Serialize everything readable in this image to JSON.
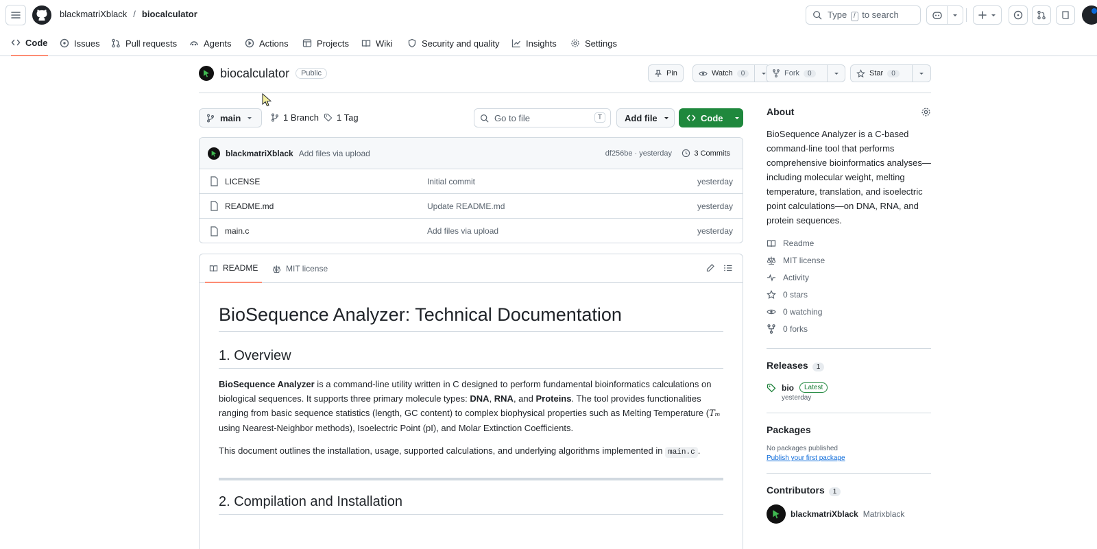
{
  "header": {
    "owner": "blackmatriXblack",
    "separator": "/",
    "repo": "biocalculator",
    "search_prefix": "Type",
    "search_key": "/",
    "search_suffix": "to search"
  },
  "nav": {
    "tabs": [
      {
        "label": "Code"
      },
      {
        "label": "Issues"
      },
      {
        "label": "Pull requests"
      },
      {
        "label": "Agents"
      },
      {
        "label": "Actions"
      },
      {
        "label": "Projects"
      },
      {
        "label": "Wiki"
      },
      {
        "label": "Security and quality"
      },
      {
        "label": "Insights"
      },
      {
        "label": "Settings"
      }
    ]
  },
  "repo": {
    "name": "biocalculator",
    "visibility": "Public",
    "pin_label": "Pin",
    "watch_label": "Watch",
    "watch_count": "0",
    "fork_label": "Fork",
    "fork_count": "0",
    "star_label": "Star",
    "star_count": "0"
  },
  "branch_bar": {
    "branch": "main",
    "branches": "1 Branch",
    "tags": "1 Tag",
    "goto_placeholder": "Go to file",
    "goto_key": "T",
    "add_file": "Add file",
    "code": "Code"
  },
  "commit": {
    "author": "blackmatriXblack",
    "message": "Add files via upload",
    "hash_time": "df256be · yesterday",
    "commits": "3 Commits"
  },
  "files": [
    {
      "name": "LICENSE",
      "message": "Initial commit",
      "date": "yesterday"
    },
    {
      "name": "README.md",
      "message": "Update README.md",
      "date": "yesterday"
    },
    {
      "name": "main.c",
      "message": "Add files via upload",
      "date": "yesterday"
    }
  ],
  "readme": {
    "tab_readme": "README",
    "tab_license": "MIT license",
    "h1": "BioSequence Analyzer: Technical Documentation",
    "h2_overview": "1. Overview",
    "p1_bold": "BioSequence Analyzer",
    "p1_a": " is a command-line utility written in C designed to perform fundamental bioinformatics calculations on biological sequences. It supports three primary molecule types: ",
    "p1_dna": "DNA",
    "p1_sep1": ", ",
    "p1_rna": "RNA",
    "p1_sep2": ", and ",
    "p1_proteins": "Proteins",
    "p1_b": ". The tool provides functionalities ranging from basic sequence statistics (length, GC content) to complex biophysical properties such as Melting Temperature (",
    "p1_tm": "Tₘ",
    "p1_c": " using Nearest-Neighbor methods), Isoelectric Point (pI), and Molar Extinction Coefficients.",
    "p2_a": "This document outlines the installation, usage, supported calculations, and underlying algorithms implemented in ",
    "p2_code": "main.c",
    "p2_b": ".",
    "h2_compile": "2. Compilation and Installation"
  },
  "about": {
    "title": "About",
    "description": "BioSequence Analyzer is a C-based command-line tool that performs comprehensive bioinformatics analyses—including molecular weight, melting temperature, translation, and isoelectric point calculations—on DNA, RNA, and protein sequences.",
    "links": [
      {
        "label": "Readme"
      },
      {
        "label": "MIT license"
      },
      {
        "label": "Activity"
      },
      {
        "label": "0 stars"
      },
      {
        "label": "0 watching"
      },
      {
        "label": "0 forks"
      }
    ]
  },
  "releases": {
    "title": "Releases",
    "count": "1",
    "tag": "bio",
    "badge": "Latest",
    "date": "yesterday"
  },
  "packages": {
    "title": "Packages",
    "none": "No packages published",
    "link": "Publish your first package"
  },
  "contributors": {
    "title": "Contributors",
    "count": "1",
    "login": "blackmatriXblack",
    "name": "Matrixblack"
  },
  "colors": {
    "accent_green": "#1f883d",
    "tab_underline": "#fd8c73",
    "link_blue": "#0969da"
  }
}
